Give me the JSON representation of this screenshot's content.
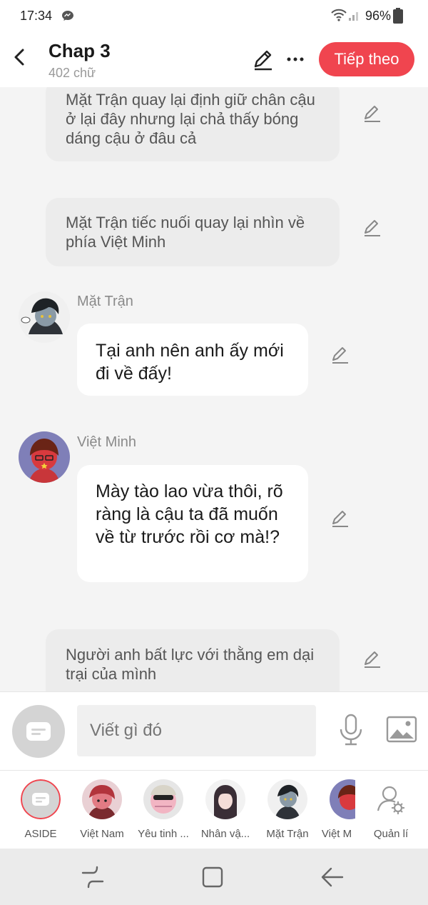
{
  "status": {
    "time": "17:34",
    "battery": "96%"
  },
  "header": {
    "title": "Chap 3",
    "word_count": "402 chữ",
    "next_label": "Tiếp theo"
  },
  "messages": [
    {
      "kind": "narration",
      "text": "Mặt Trận quay lại định giữ chân cậu ở lại đây nhưng lại chả thấy bóng dáng cậu ở đâu cả"
    },
    {
      "kind": "narration",
      "text": "Mặt Trận tiếc nuối quay lại nhìn về phía Việt Minh"
    },
    {
      "kind": "dialogue",
      "speaker": "Mặt Trận",
      "text": "Tại anh nên anh ấy mới đi về đấy!"
    },
    {
      "kind": "dialogue",
      "speaker": "Việt Minh",
      "text": "Mày tào lao vừa thôi, rõ ràng là cậu ta đã muốn về từ trước rồi cơ mà!?"
    },
    {
      "kind": "narration",
      "text": "Người anh bất lực với thằng em dại trại của mình"
    }
  ],
  "composer": {
    "placeholder": "Viết gì đó"
  },
  "characters": [
    {
      "label": "ASIDE"
    },
    {
      "label": "Việt Nam"
    },
    {
      "label": "Yêu tinh ..."
    },
    {
      "label": "Nhân vậ..."
    },
    {
      "label": "Mặt Trận"
    },
    {
      "label": "Việt M"
    },
    {
      "label": "Quản lí"
    }
  ],
  "colors": {
    "accent": "#f0454f",
    "narration_bg": "#ececec",
    "chat_bg": "#f4f4f4"
  }
}
